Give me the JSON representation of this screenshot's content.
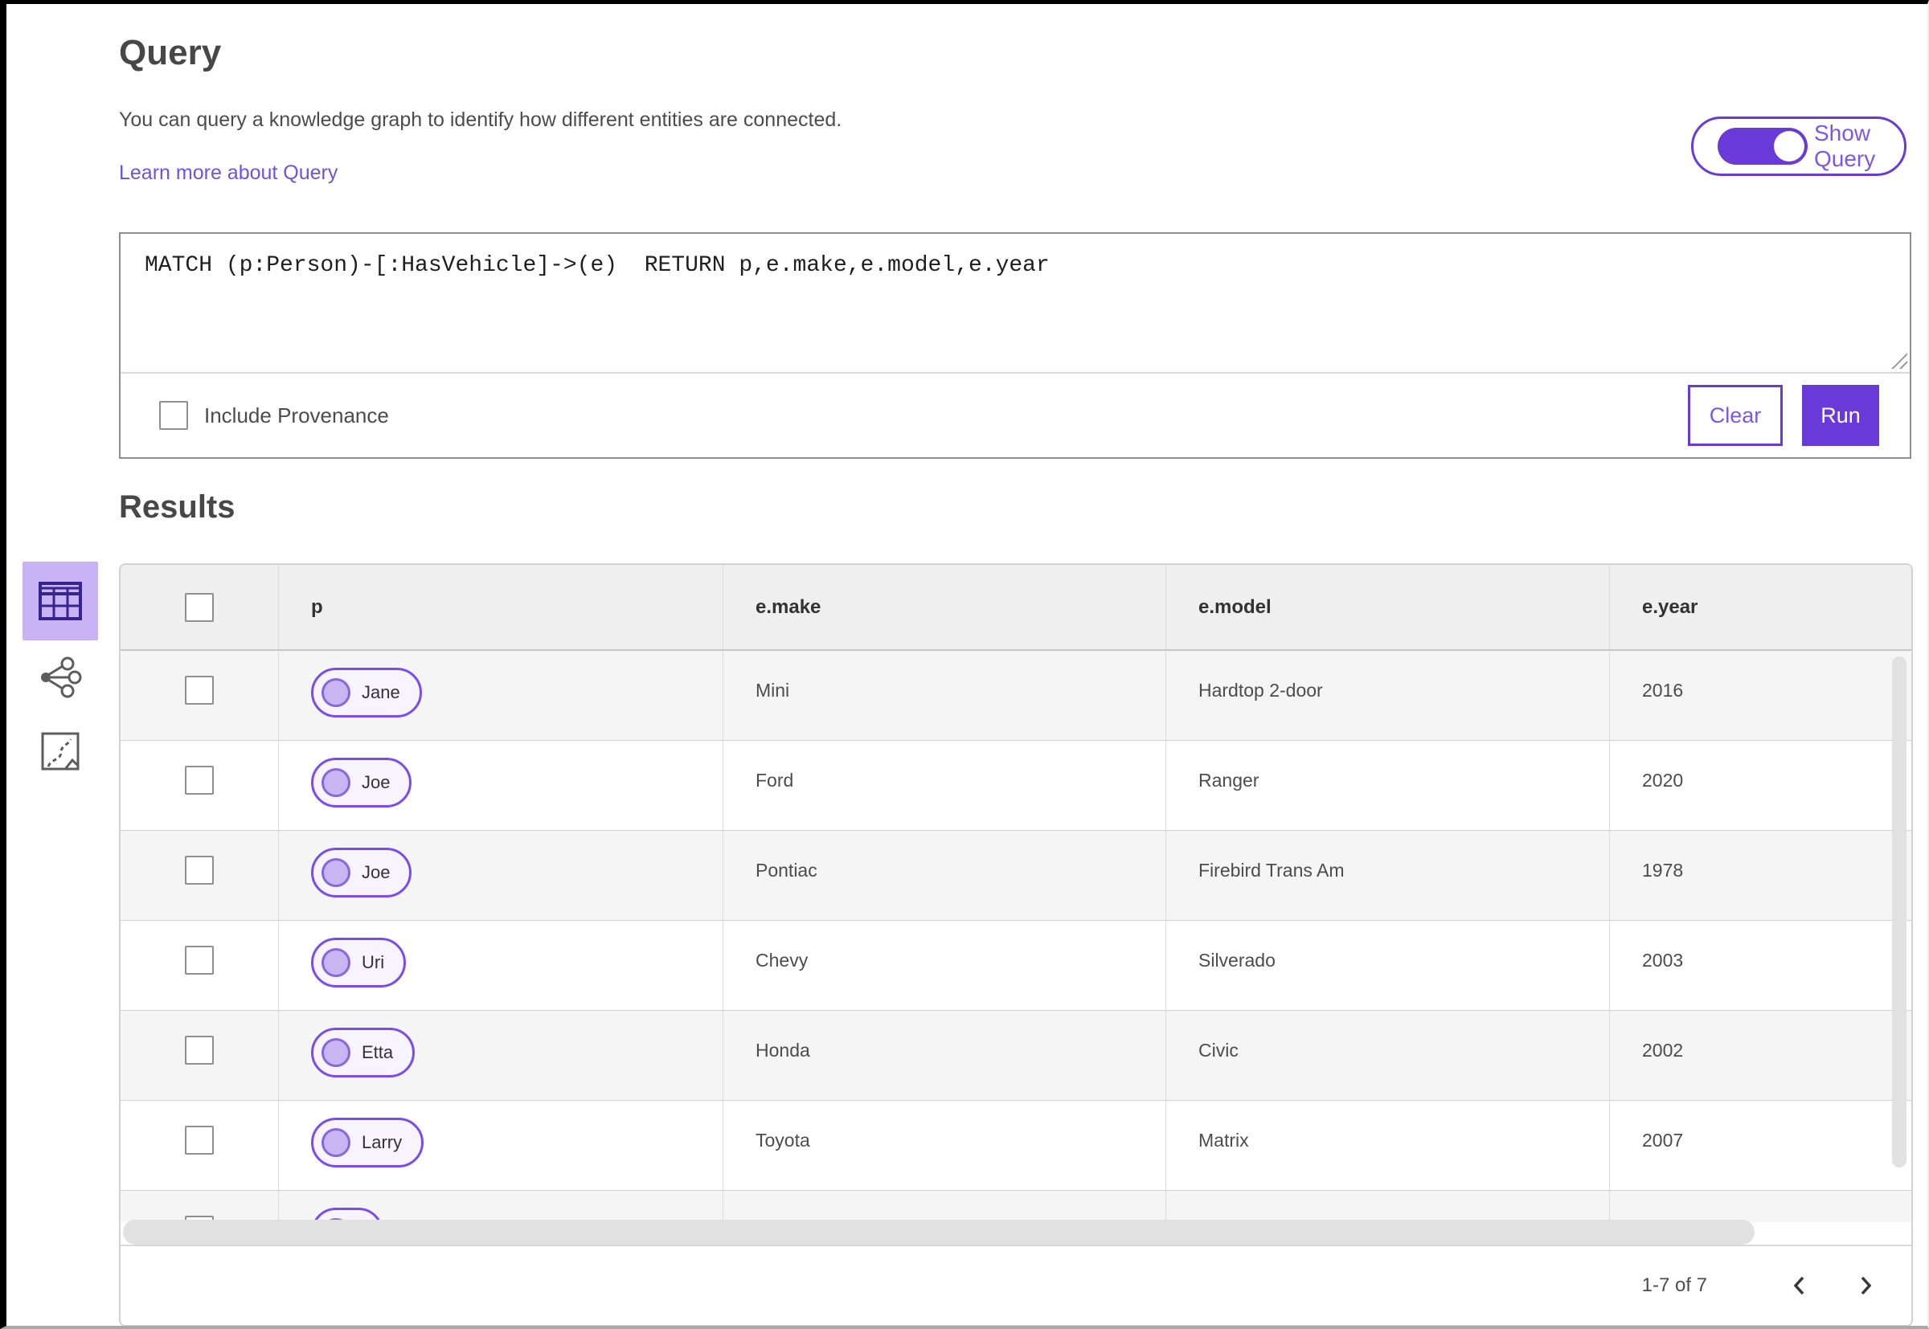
{
  "query_panel": {
    "title": "Query",
    "description": "You can query a knowledge graph to identify how different entities are connected.",
    "learn_more_link": "Learn more about Query",
    "show_query_toggle": {
      "label": "Show Query",
      "state": "on"
    },
    "query_text": "MATCH (p:Person)-[:HasVehicle]->(e)  RETURN p,e.make,e.model,e.year",
    "include_provenance": {
      "label": "Include Provenance",
      "checked": false
    },
    "buttons": {
      "clear": "Clear",
      "run": "Run"
    }
  },
  "results_panel": {
    "title": "Results",
    "view_switcher": [
      {
        "icon": "table-view-icon",
        "selected": true
      },
      {
        "icon": "link-chart-view-icon",
        "selected": false
      },
      {
        "icon": "map-view-icon",
        "selected": false
      }
    ],
    "table": {
      "columns": [
        "p",
        "e.make",
        "e.model",
        "e.year"
      ],
      "rows": [
        {
          "p": "Jane",
          "make": "Mini",
          "model": "Hardtop 2-door",
          "year": "2016"
        },
        {
          "p": "Joe",
          "make": "Ford",
          "model": "Ranger",
          "year": "2020"
        },
        {
          "p": "Joe",
          "make": "Pontiac",
          "model": "Firebird Trans Am",
          "year": "1978"
        },
        {
          "p": "Uri",
          "make": "Chevy",
          "model": "Silverado",
          "year": "2003"
        },
        {
          "p": "Etta",
          "make": "Honda",
          "model": "Civic",
          "year": "2002"
        },
        {
          "p": "Larry",
          "make": "Toyota",
          "model": "Matrix",
          "year": "2007"
        },
        {
          "p": "",
          "make": "",
          "model": "",
          "year": ""
        }
      ]
    },
    "pagination": {
      "range_label": "1-7 of 7",
      "prev_icon": "chevron-left-icon",
      "next_icon": "chevron-right-icon"
    }
  },
  "colors": {
    "accent_purple": "#6a3ad9",
    "accent_light_purple": "#c9b3f5",
    "link_purple": "#6d52e3",
    "pill_border": "#7a4cf0",
    "header_bg": "#efefef",
    "alt_row_bg": "#f5f5f5"
  }
}
